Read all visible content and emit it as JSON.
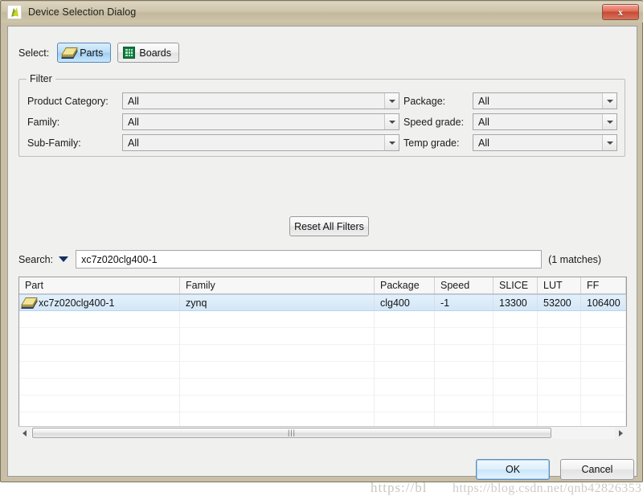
{
  "window": {
    "title": "Device Selection Dialog",
    "app_icon": "xilinx-logo-icon",
    "close_label": "x"
  },
  "select_row": {
    "label": "Select:",
    "buttons": [
      {
        "label": "Parts",
        "icon": "chip-icon",
        "selected": true
      },
      {
        "label": "Boards",
        "icon": "board-icon",
        "selected": false
      }
    ]
  },
  "filter": {
    "legend": "Filter",
    "left_fields": [
      {
        "label": "Product Category:",
        "value": "All"
      },
      {
        "label": "Family:",
        "value": "All"
      },
      {
        "label": "Sub-Family:",
        "value": "All"
      }
    ],
    "right_fields": [
      {
        "label": "Package:",
        "value": "All"
      },
      {
        "label": "Speed grade:",
        "value": "All"
      },
      {
        "label": "Temp grade:",
        "value": "All"
      }
    ],
    "reset_label": "Reset All Filters"
  },
  "search": {
    "label": "Search:",
    "value": "xc7z020clg400-1",
    "placeholder": "",
    "matches": "(1 matches)",
    "dropdown_icon": "chevron-down-icon"
  },
  "table": {
    "columns": [
      "Part",
      "Family",
      "Package",
      "Speed",
      "SLICE",
      "LUT",
      "FF"
    ],
    "rows": [
      {
        "icon": "chip-icon",
        "cells": [
          "xc7z020clg400-1",
          "zynq",
          "clg400",
          "-1",
          "13300",
          "53200",
          "106400"
        ],
        "selected": true
      }
    ],
    "empty_row_count": 7
  },
  "scrollbar": {
    "left_arrow": "arrow-left-icon",
    "right_arrow": "arrow-right-icon",
    "grip": "|||"
  },
  "buttons": {
    "ok": "OK",
    "cancel": "Cancel"
  },
  "watermark": {
    "line1": "https://bl",
    "line2": "https://blog.csdn.net/qnb42826353"
  },
  "colors": {
    "titlebar": "#cfc6ad",
    "frame": "#c9bfa6",
    "client_bg": "#f0f0ef",
    "accent_blue": "#5a8ebd",
    "selection_blue": "#d3e7f8",
    "close_red": "#c44a33"
  }
}
